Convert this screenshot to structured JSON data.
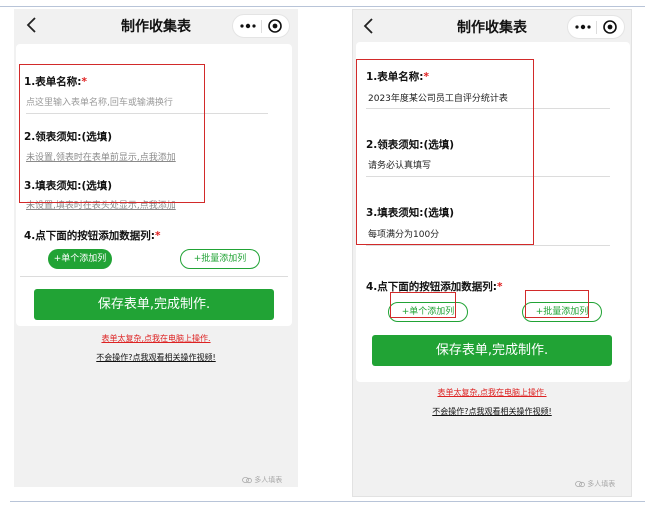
{
  "screens": [
    {
      "nav_title": "制作收集表",
      "field1": {
        "label": "1.表单名称:",
        "required_mark": "*",
        "placeholder": "点这里输入表单名称,回车或输满换行"
      },
      "field2": {
        "label": "2.领表须知:(选填)",
        "value": "未设置,领表时在表单前显示,点我添加"
      },
      "field3": {
        "label": "3.填表须知:(选填)",
        "value": "未设置,填表时在表头处显示,点我添加"
      },
      "section4": {
        "label": "4.点下面的按钮添加数据列:",
        "required_mark": "*"
      },
      "add_single_label": "+单个添加列",
      "add_batch_label": "+批量添加列",
      "save_label": "保存表单,完成制作.",
      "complex_link": "表单太复杂,点我在电脑上操作.",
      "help_link": "不会操作?点我观看相关操作视频!",
      "watermark": "多人填表"
    },
    {
      "nav_title": "制作收集表",
      "field1": {
        "label": "1.表单名称:",
        "required_mark": "*",
        "value": "2023年度某公司员工自评分统计表"
      },
      "field2": {
        "label": "2.领表须知:(选填)",
        "value": "请务必认真填写"
      },
      "field3": {
        "label": "3.填表须知:(选填)",
        "value": "每项满分为100分"
      },
      "section4": {
        "label": "4.点下面的按钮添加数据列:",
        "required_mark": "*"
      },
      "add_single_label": "+单个添加列",
      "add_batch_label": "+批量添加列",
      "save_label": "保存表单,完成制作.",
      "complex_link": "表单太复杂,点我在电脑上操作.",
      "help_link": "不会操作?点我观看相关操作视频!",
      "watermark": "多人填表"
    }
  ],
  "colors": {
    "accent_green": "#21a335",
    "annotation_red": "#d22a2a",
    "required_red": "#e02020"
  },
  "icons": [
    "back-chevron-icon",
    "more-dots-icon",
    "target-circle-icon",
    "watermark-logo-icon"
  ]
}
